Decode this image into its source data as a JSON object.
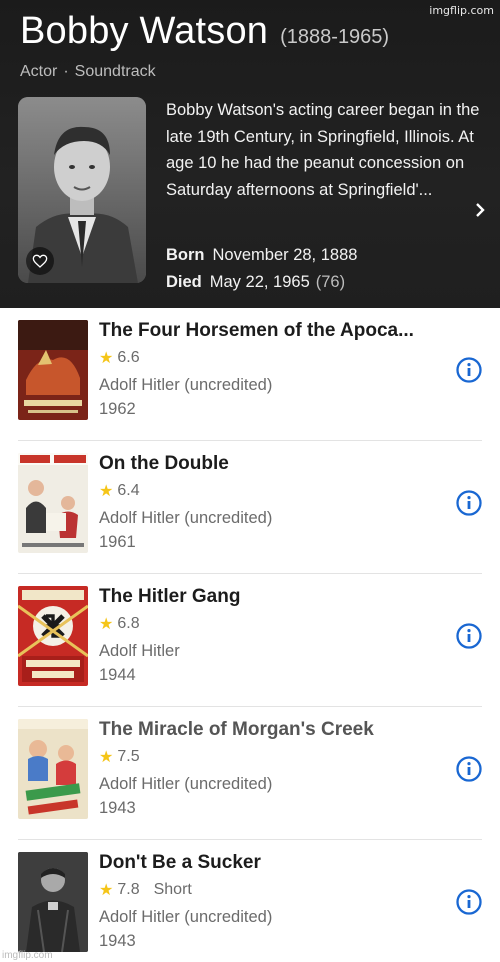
{
  "watermark": "imgflip.com",
  "footer_watermark": "imgflip.com",
  "person": {
    "name": "Bobby Watson",
    "years": "(1888-1965)",
    "roles": [
      "Actor",
      "Soundtrack"
    ],
    "separator": "·",
    "bio": "Bobby Watson's acting career began in the late 19th Century, in Springfield, Illinois. At age 10 he had the peanut concession on Saturday afternoons at Springfield'...",
    "born_label": "Born",
    "born_value": "November 28, 1888",
    "died_label": "Died",
    "died_value": "May 22, 1965",
    "died_age": "(76)"
  },
  "credits": [
    {
      "title": "The Four Horsemen of the Apoca...",
      "rating": "6.6",
      "type": "",
      "role": "Adolf Hitler (uncredited)",
      "year": "1962",
      "poster_color": "#8a2d1f"
    },
    {
      "title": "On the Double",
      "rating": "6.4",
      "type": "",
      "role": "Adolf Hitler (uncredited)",
      "year": "1961",
      "poster_color": "#f0ede4"
    },
    {
      "title": "The Hitler Gang",
      "rating": "6.8",
      "type": "",
      "role": "Adolf Hitler",
      "year": "1944",
      "poster_color": "#c62a24"
    },
    {
      "title": "The Miracle of Morgan's Creek",
      "rating": "7.5",
      "type": "",
      "role": "Adolf Hitler (uncredited)",
      "year": "1943",
      "poster_color": "#e9dcc0"
    },
    {
      "title": "Don't Be a Sucker",
      "rating": "7.8",
      "type": "Short",
      "role": "Adolf Hitler (uncredited)",
      "year": "1943",
      "poster_color": "#4a4a4a"
    }
  ],
  "colors": {
    "star": "#f5c518",
    "info": "#1967d2",
    "header_bg": "#1f1f1f"
  },
  "icons": {
    "favorite": "heart-icon",
    "more": "chevron-right-icon",
    "info": "info-icon",
    "rating": "star-icon"
  }
}
